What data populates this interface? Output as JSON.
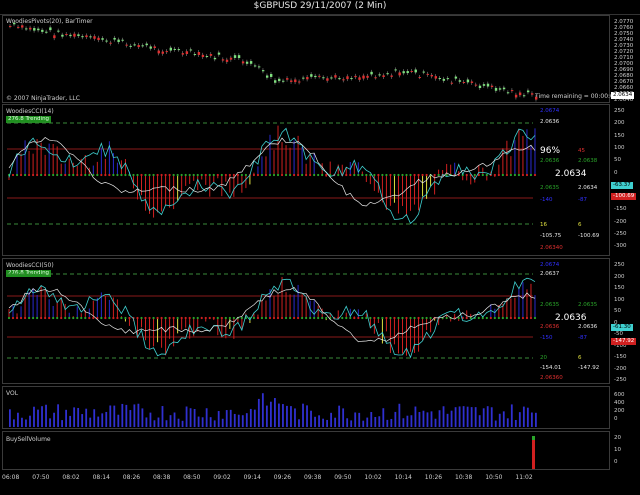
{
  "window": {
    "title": "$GBPUSD  29/11/2007  (2 Min)"
  },
  "price_panel": {
    "label": "WoodiesPivots(20), BarTimer",
    "copyright": "© 2007 NinjaTrader, LLC",
    "time_remaining": "Time remaining = 00:00:04",
    "last_price": "2.0634",
    "axis_ticks": [
      "2.0770",
      "2.0760",
      "2.0750",
      "2.0740",
      "2.0730",
      "2.0720",
      "2.0710",
      "2.0700",
      "2.0690",
      "2.0680",
      "2.0670",
      "2.0660",
      "2.0650",
      "2.0640"
    ]
  },
  "cci14": {
    "label": "WoodiesCCI(14)",
    "trend_badge": "276.8 Trending",
    "top_value": "2.0674",
    "level_200": "2.0636",
    "pct": "96%",
    "n45": "45",
    "v_left": "2.0636",
    "v_right": "2.0638",
    "price": "2.0634",
    "r2_left": "2.0635",
    "r2_right": "2.0634",
    "s1_left": "-140",
    "s1_right": "-87",
    "n16": "16",
    "n6": "6",
    "vals_left": "-105.75",
    "vals_right": "-100.69",
    "bottom": "2.06340",
    "badge_cyan": "-63.37",
    "badge_red": "-100.69",
    "axis_ticks": [
      "250",
      "200",
      "150",
      "100",
      "50",
      "0",
      "-50",
      "-100",
      "-150",
      "-200",
      "-250",
      "-300"
    ]
  },
  "cci50": {
    "label": "WoodiesCCI(50)",
    "trend_badge": "276.8 Trending",
    "top_value": "2.0674",
    "level_200": "2.0637",
    "v_left": "2.0635",
    "v_right": "2.0635",
    "price": "2.0636",
    "r2_left": "2.0636",
    "r2_right": "2.0636",
    "s1_left": "-150",
    "s1_right": "-87",
    "n20": "20",
    "n6": "6",
    "vals_left": "-154.01",
    "vals_right": "-147.92",
    "bottom": "2.06360",
    "badge_cyan": "-61.30",
    "badge_red": "-147.92",
    "axis_ticks": [
      "250",
      "200",
      "150",
      "100",
      "50",
      "0",
      "-50",
      "-100",
      "-150",
      "-200",
      "-250"
    ]
  },
  "vol": {
    "label": "VOL",
    "axis_ticks": [
      "600",
      "400",
      "200",
      "0"
    ]
  },
  "bsv": {
    "label": "BuySellVolume",
    "axis_ticks": [
      "20",
      "10",
      "0"
    ]
  },
  "x_axis": [
    "06:08",
    "07:50",
    "08:02",
    "08:14",
    "08:26",
    "08:38",
    "08:50",
    "09:02",
    "09:14",
    "09:26",
    "09:38",
    "09:50",
    "10:02",
    "10:14",
    "10:26",
    "10:38",
    "10:50",
    "11:02"
  ],
  "colors": {
    "up": "#7fe07f",
    "down": "#e03030",
    "cyan": "#3fd0d0",
    "red": "#d02020",
    "green": "#2aa52a",
    "blue": "#2a2ad0",
    "yellow": "#e0e040"
  }
}
